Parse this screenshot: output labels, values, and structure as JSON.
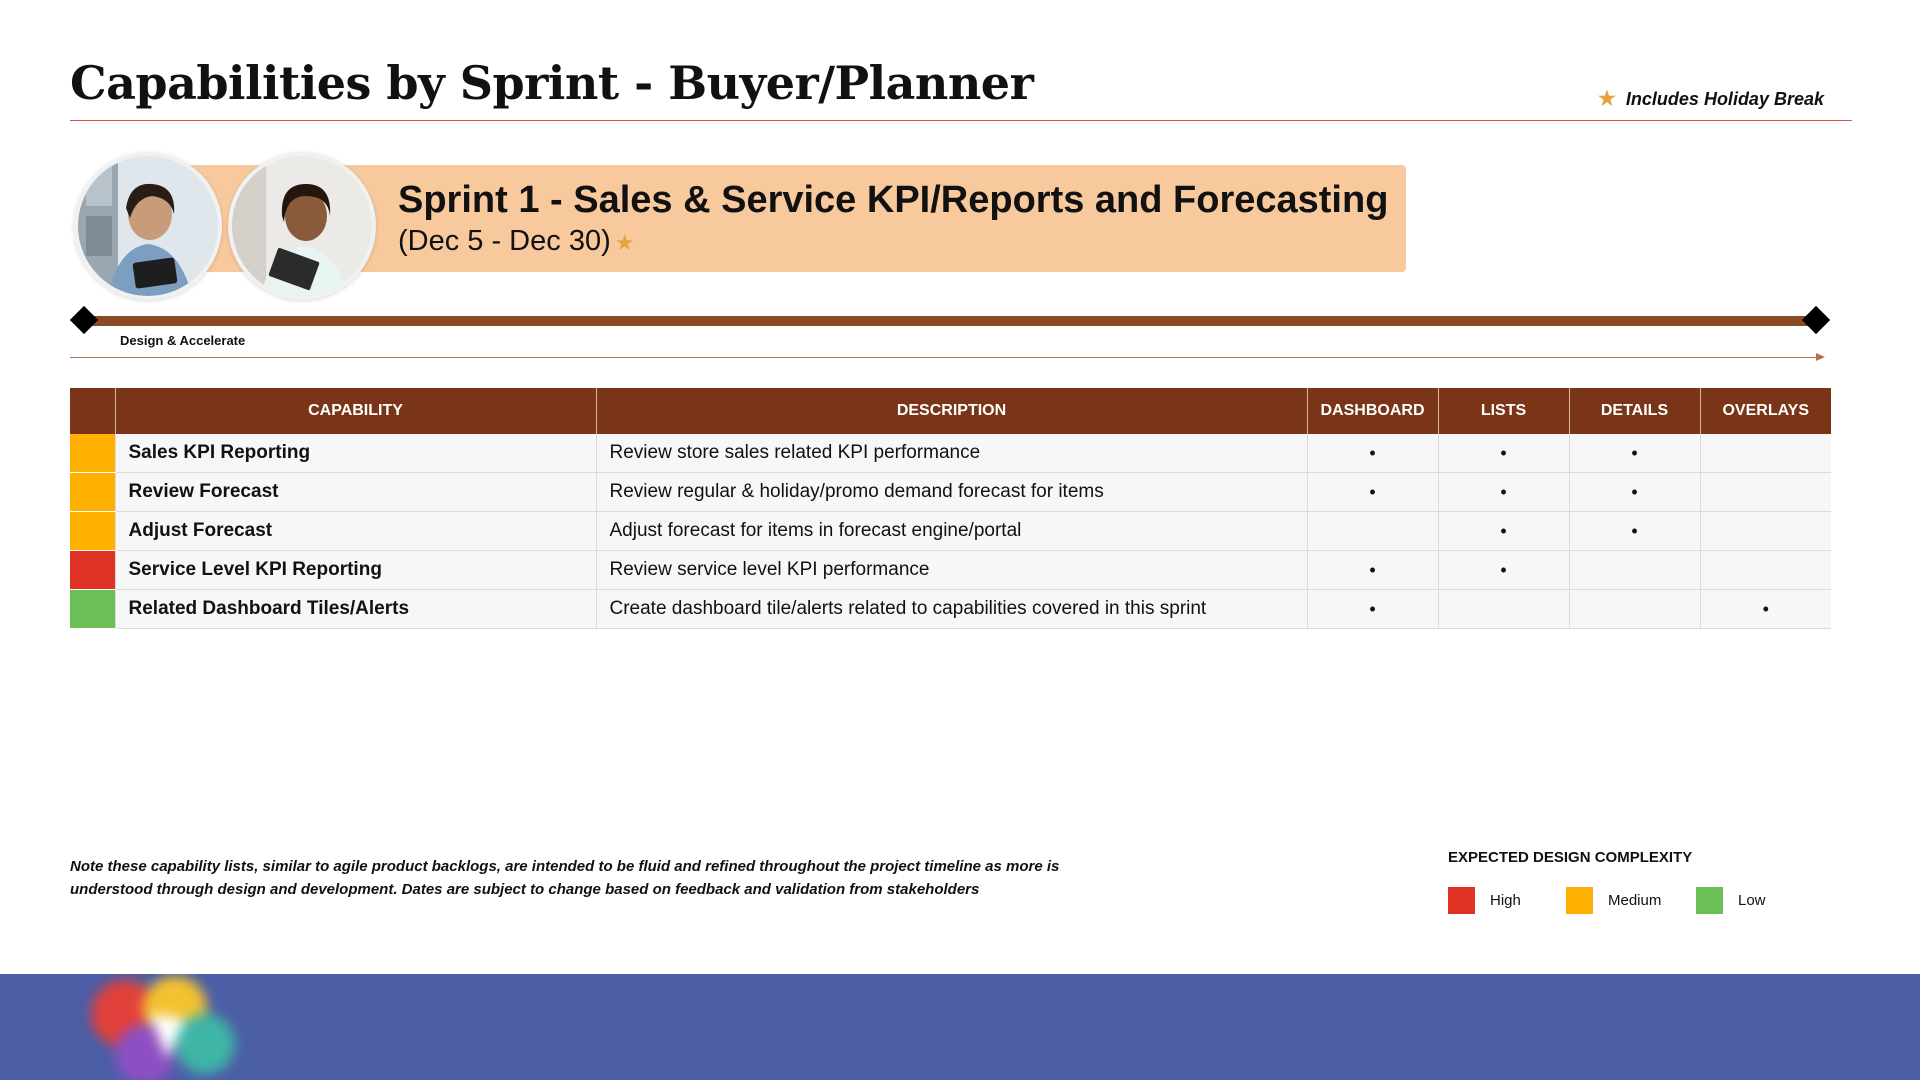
{
  "header": {
    "title": "Capabilities by Sprint - Buyer/Planner",
    "holiday_note": "Includes Holiday Break"
  },
  "banner": {
    "title": "Sprint 1 - Sales & Service KPI/Reports and Forecasting",
    "dates": "(Dec 5 - Dec 30)"
  },
  "timeline": {
    "phase_label": "Design & Accelerate"
  },
  "table": {
    "columns": [
      "CAPABILITY",
      "DESCRIPTION",
      "DASHBOARD",
      "LISTS",
      "DETAILS",
      "OVERLAYS"
    ],
    "rows": [
      {
        "complexity": "medium",
        "capability": "Sales KPI Reporting",
        "description": "Review store sales related KPI performance",
        "dashboard": "•",
        "lists": "•",
        "details": "•",
        "overlays": ""
      },
      {
        "complexity": "medium",
        "capability": "Review Forecast",
        "description": "Review regular & holiday/promo demand forecast for items",
        "dashboard": "•",
        "lists": "•",
        "details": "•",
        "overlays": ""
      },
      {
        "complexity": "medium",
        "capability": "Adjust Forecast",
        "description": "Adjust forecast for items in forecast engine/portal",
        "dashboard": "",
        "lists": "•",
        "details": "•",
        "overlays": ""
      },
      {
        "complexity": "high",
        "capability": "Service Level KPI Reporting",
        "description": "Review service level KPI performance",
        "dashboard": "•",
        "lists": "•",
        "details": "",
        "overlays": ""
      },
      {
        "complexity": "low",
        "capability": "Related Dashboard Tiles/Alerts",
        "description": "Create dashboard tile/alerts related to capabilities covered in this sprint",
        "dashboard": "•",
        "lists": "",
        "details": "",
        "overlays": "•"
      }
    ]
  },
  "note": "Note these capability lists, similar to agile product backlogs, are intended to be fluid and refined throughout the project timeline as more is understood through design and development. Dates are subject to change based on feedback and validation from stakeholders",
  "legend": {
    "title": "EXPECTED DESIGN COMPLEXITY",
    "items": [
      {
        "key": "high",
        "label": "High"
      },
      {
        "key": "medium",
        "label": "Medium"
      },
      {
        "key": "low",
        "label": "Low"
      }
    ]
  },
  "colors": {
    "high": "#e03224",
    "medium": "#ffb000",
    "low": "#6cbf56",
    "table_header": "#7a3519",
    "timeline": "#8b4a26",
    "banner": "#f8c99c",
    "footer": "#4b5ea6",
    "star": "#e6a23c"
  },
  "icons": {
    "holiday": "star-icon"
  }
}
